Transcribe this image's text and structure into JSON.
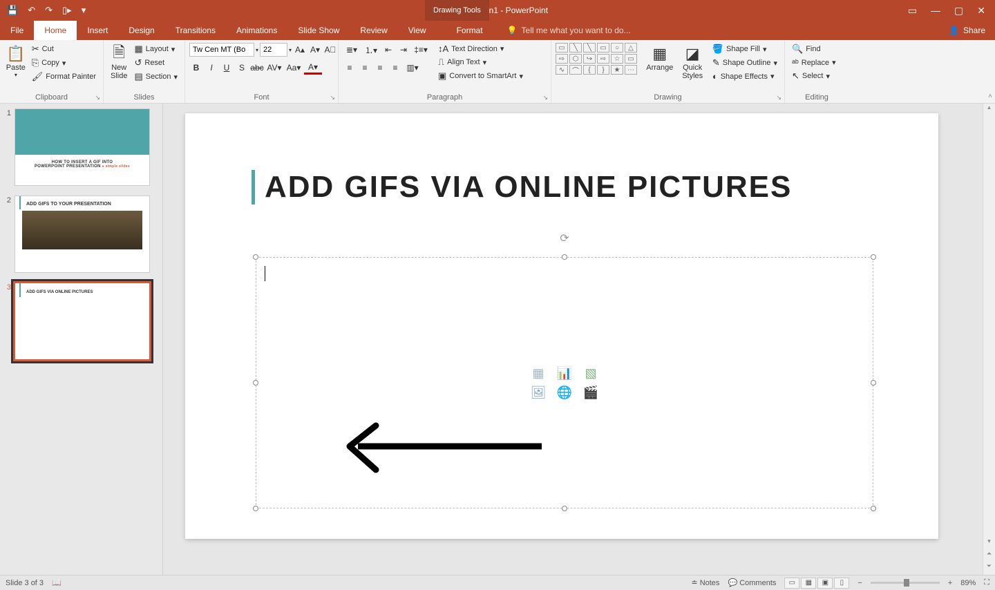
{
  "titlebar": {
    "app_title": "Presentation1 - PowerPoint",
    "context_tab": "Drawing Tools",
    "qat": {
      "save": "💾",
      "undo": "↶",
      "redo": "↷",
      "start": "▯▸"
    }
  },
  "tabs": {
    "file": "File",
    "home": "Home",
    "insert": "Insert",
    "design": "Design",
    "transitions": "Transitions",
    "animations": "Animations",
    "slideshow": "Slide Show",
    "review": "Review",
    "view": "View",
    "format": "Format",
    "tellme_placeholder": "Tell me what you want to do...",
    "share": "Share"
  },
  "ribbon": {
    "clipboard": {
      "label": "Clipboard",
      "paste": "Paste",
      "cut": "Cut",
      "copy": "Copy",
      "format_painter": "Format Painter"
    },
    "slides": {
      "label": "Slides",
      "new_slide": "New\nSlide",
      "layout": "Layout",
      "reset": "Reset",
      "section": "Section"
    },
    "font": {
      "label": "Font",
      "family": "Tw Cen MT (Bo",
      "size": "22"
    },
    "paragraph": {
      "label": "Paragraph",
      "text_direction": "Text Direction",
      "align_text": "Align Text",
      "convert_smartart": "Convert to SmartArt"
    },
    "drawing": {
      "label": "Drawing",
      "arrange": "Arrange",
      "quick_styles": "Quick\nStyles",
      "shape_fill": "Shape Fill",
      "shape_outline": "Shape Outline",
      "shape_effects": "Shape Effects"
    },
    "editing": {
      "label": "Editing",
      "find": "Find",
      "replace": "Replace",
      "select": "Select"
    }
  },
  "thumbs": {
    "s1_line1": "HOW TO INSERT A GIF INTO",
    "s1_line2": "POWERPOINT PRESENTATION",
    "s2_title": "ADD GIFS TO YOUR PRESENTATION",
    "s3_title": "ADD GIFS VIA  ONLINE PICTURES",
    "selected_num": "3"
  },
  "slide": {
    "title": "ADD GIFS VIA ONLINE PICTURES"
  },
  "status": {
    "slide_info": "Slide 3 of 3",
    "notes": "Notes",
    "comments": "Comments",
    "zoom": "89%"
  }
}
